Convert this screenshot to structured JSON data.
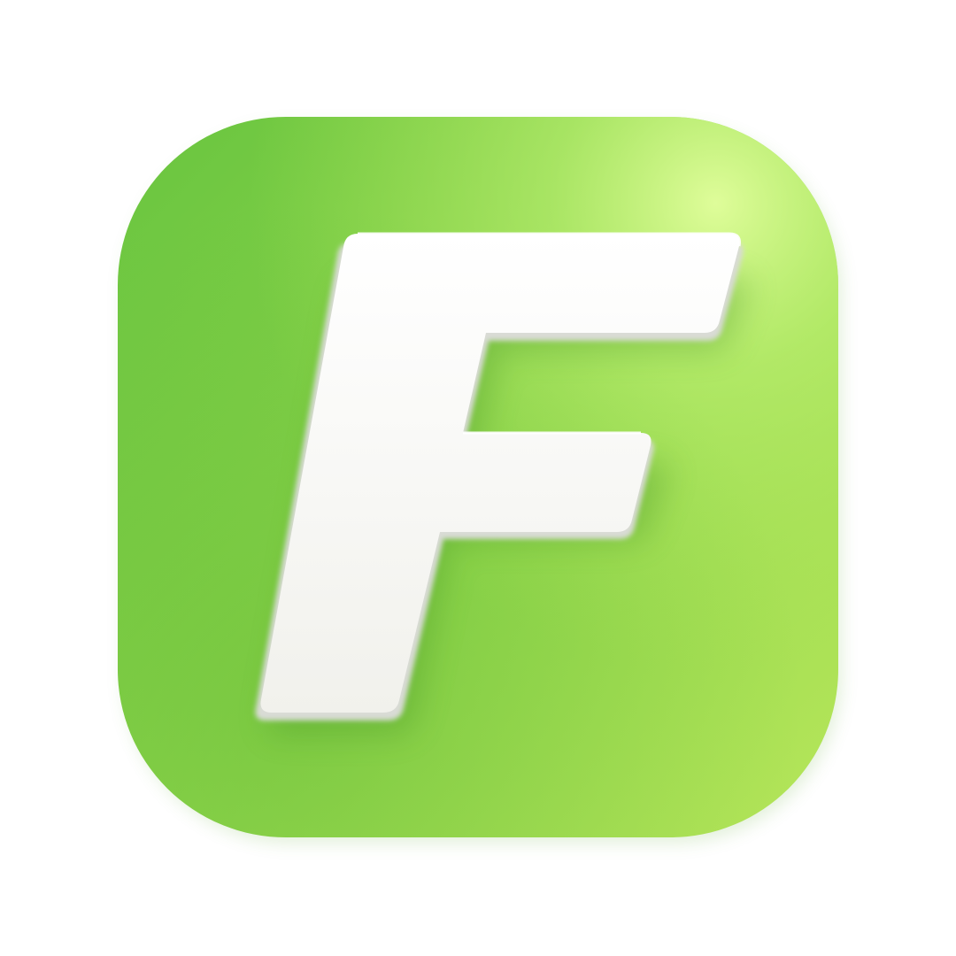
{
  "icon": {
    "semantic_name": "letter-f-app-icon",
    "letter": "F",
    "colors": {
      "tile_light": "#d6fb93",
      "tile_mid": "#a8e252",
      "tile_dark": "#68c43f",
      "tile_edge_shadow": "#4aa42d",
      "letter_face": "#f5f5f1",
      "letter_side": "#d9dbd5",
      "letter_shadow": "#3f8f22"
    }
  }
}
